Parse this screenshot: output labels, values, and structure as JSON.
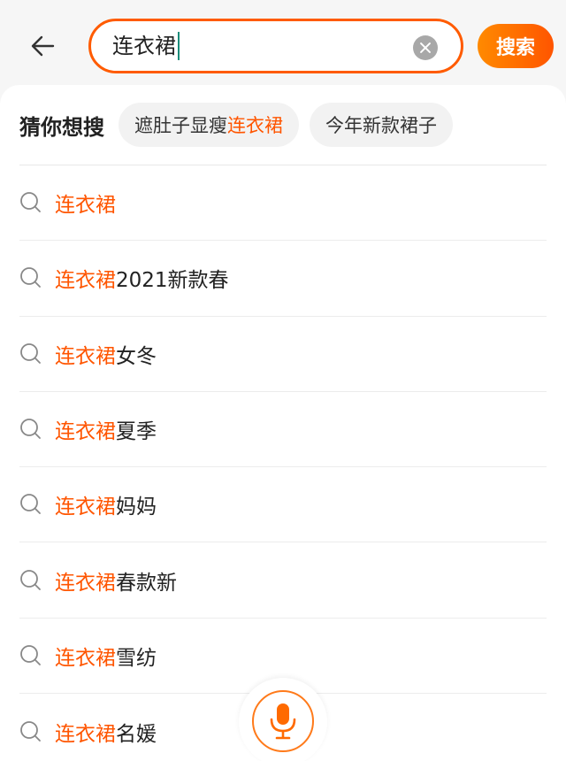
{
  "search": {
    "query": "连衣裙",
    "button_label": "搜索"
  },
  "guess": {
    "label": "猜你想搜",
    "chips": [
      {
        "prefix": "遮肚子显瘦",
        "highlight": "连衣裙"
      },
      {
        "prefix": "今年新款裙子",
        "highlight": ""
      }
    ]
  },
  "suggestions": [
    {
      "highlight": "连衣裙",
      "suffix": ""
    },
    {
      "highlight": "连衣裙",
      "suffix": "2021新款春"
    },
    {
      "highlight": "连衣裙",
      "suffix": "女冬"
    },
    {
      "highlight": "连衣裙",
      "suffix": "夏季"
    },
    {
      "highlight": "连衣裙",
      "suffix": "妈妈"
    },
    {
      "highlight": "连衣裙",
      "suffix": "春款新"
    },
    {
      "highlight": "连衣裙",
      "suffix": "雪纺"
    },
    {
      "highlight": "连衣裙",
      "suffix": "名媛"
    }
  ],
  "colors": {
    "accent": "#ff5500",
    "search_border": "#ff5b00",
    "caret": "#1a8c7a"
  },
  "icons": {
    "back": "arrow-left-icon",
    "clear": "clear-icon",
    "search": "search-icon",
    "mic": "microphone-icon"
  }
}
